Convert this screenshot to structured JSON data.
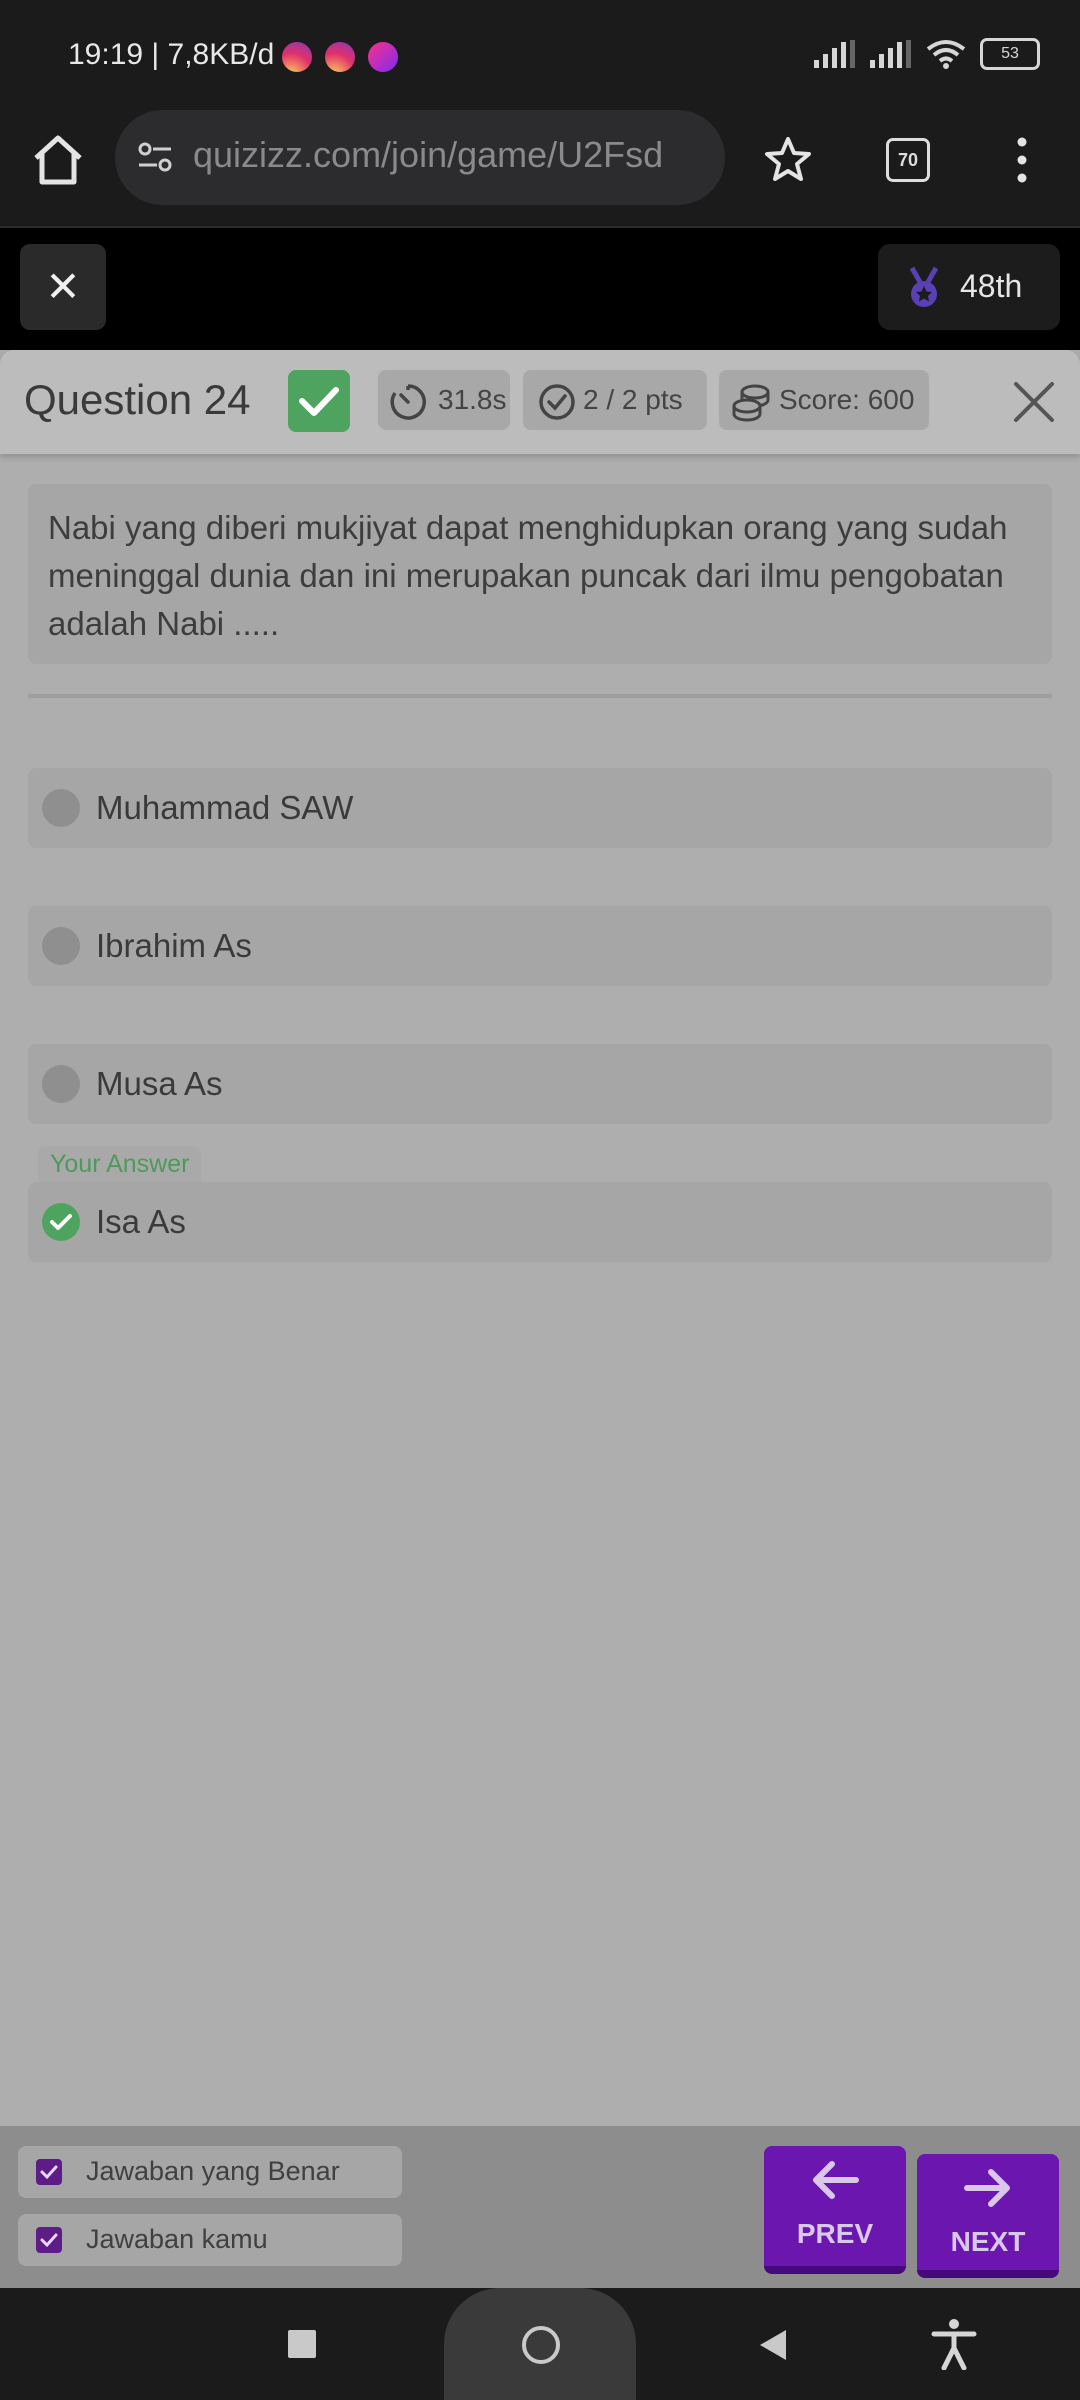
{
  "status_bar": {
    "time_speed": "19:19 | 7,8KB/d",
    "battery": "53",
    "notification_icons": [
      "instagram-icon",
      "instagram-icon",
      "picsart-icon"
    ]
  },
  "browser": {
    "url": "quizizz.com/join/game/U2Fsd",
    "tab_count": "70"
  },
  "quiz_top": {
    "close_label": "✕",
    "rank": "48th"
  },
  "question_header": {
    "title": "Question 24",
    "time": "31.8s",
    "points": "2 / 2 pts",
    "score": "Score: 600"
  },
  "question": {
    "text": "Nabi yang diberi mukjiyat dapat menghidupkan orang yang sudah meninggal dunia dan ini merupakan puncak dari ilmu pengobatan adalah Nabi ....."
  },
  "options": [
    {
      "label": "Muhammad SAW",
      "selected": false
    },
    {
      "label": "Ibrahim As",
      "selected": false
    },
    {
      "label": "Musa As",
      "selected": false
    },
    {
      "label": "Isa As",
      "selected": true
    }
  ],
  "your_answer_label": "Your Answer",
  "legend": {
    "correct_label": "Jawaban yang Benar",
    "yours_label": "Jawaban kamu"
  },
  "nav": {
    "prev_label": "PREV",
    "next_label": "NEXT"
  },
  "colors": {
    "correct_green": "#4ea45e",
    "nav_purple": "#6b16ae",
    "rank_medal": "#5b3fb4"
  }
}
